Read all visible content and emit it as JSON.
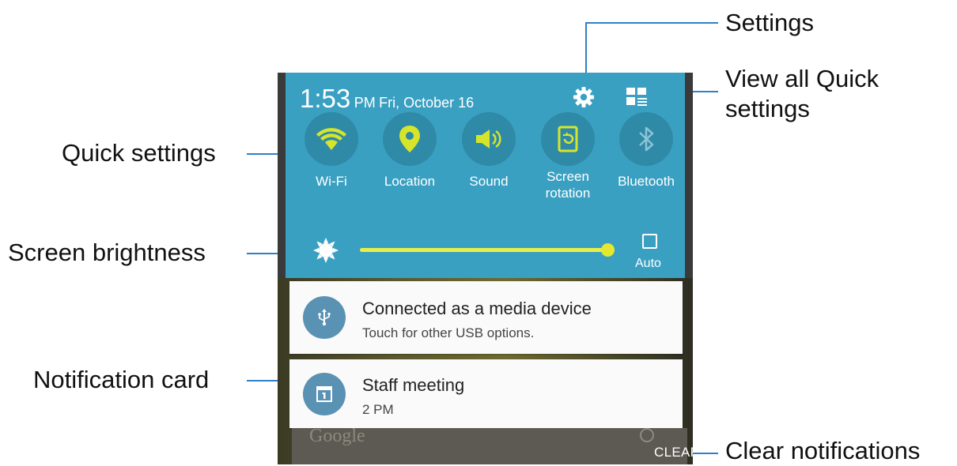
{
  "callouts": {
    "settings": "Settings",
    "view_all_line1": "View all Quick",
    "view_all_line2": "settings",
    "quick_settings": "Quick settings",
    "screen_brightness": "Screen brightness",
    "notification_card": "Notification card",
    "clear_notifications": "Clear notifications"
  },
  "status": {
    "time": "1:53",
    "ampm": "PM",
    "date": "Fri, October 16"
  },
  "header_icons": [
    "gear-icon",
    "view-all-grid-icon"
  ],
  "quick_settings": [
    {
      "label": "Wi-Fi",
      "icon": "wifi-icon",
      "active": true
    },
    {
      "label": "Location",
      "icon": "location-pin-icon",
      "active": true
    },
    {
      "label": "Sound",
      "icon": "speaker-icon",
      "active": true
    },
    {
      "label_line1": "Screen",
      "label_line2": "rotation",
      "icon": "screen-rotation-icon",
      "active": true
    },
    {
      "label": "Bluetooth",
      "icon": "bluetooth-icon",
      "active": false
    }
  ],
  "brightness": {
    "level": 1.0,
    "auto_label": "Auto",
    "auto_checked": false
  },
  "notifications": [
    {
      "title": "Connected as a media device",
      "subtitle": "Touch for other USB options.",
      "icon": "usb-icon"
    },
    {
      "title": "Staff meeting",
      "subtitle": "2 PM",
      "icon": "calendar-icon"
    }
  ],
  "background": {
    "google_text": "Google"
  },
  "clear_label": "CLEAR",
  "colors": {
    "panel": "#3aa0c2",
    "tile_circle": "#2f8aa7",
    "active_icon": "#d7e52a",
    "inactive_icon": "#8cc3d6",
    "callout_line": "#2f80c8"
  }
}
